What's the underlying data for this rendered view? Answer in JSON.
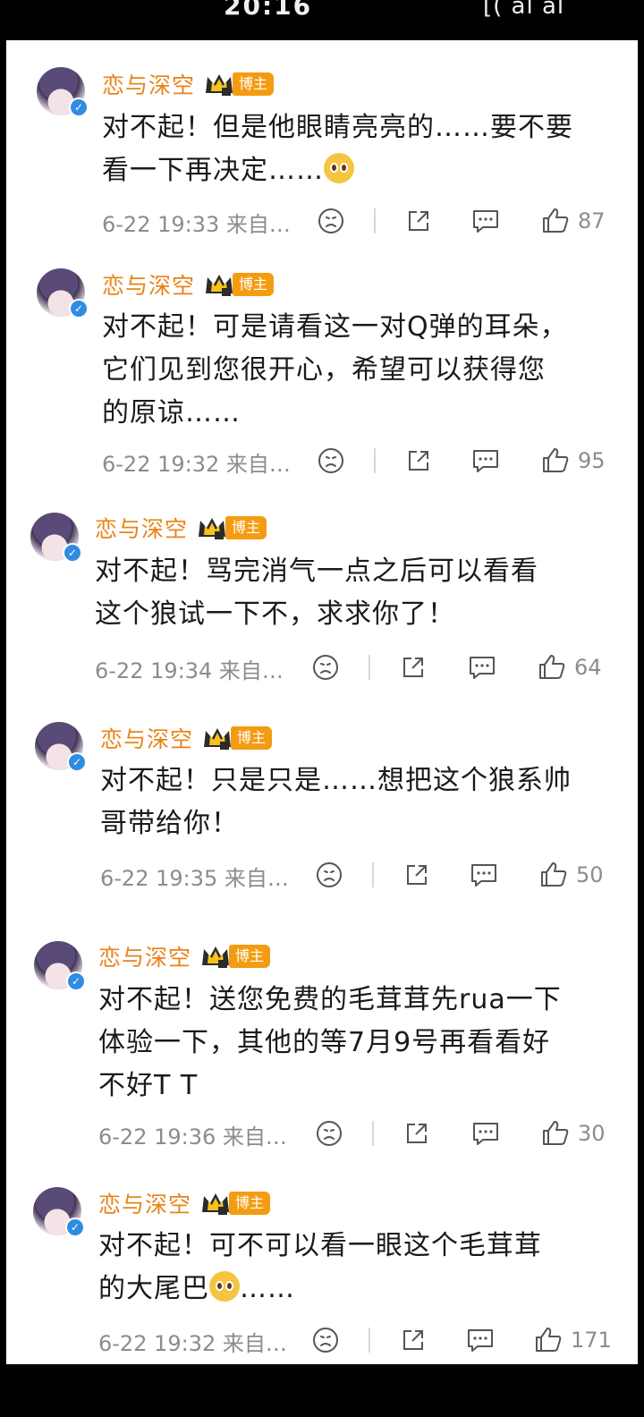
{
  "status_bar": {
    "time": "20:16",
    "icons": "[( al al"
  },
  "colors": {
    "username": "#e88418",
    "badge": "#f39c12",
    "verified": "#2f8ce0",
    "meta": "#8c8c8c"
  },
  "comments": [
    {
      "author": "恋与深空",
      "badge": "博主",
      "text": "对不起！但是他眼睛亮亮的……要不要\n看一下再决定……",
      "emoji": "pleading-face",
      "time": "6-22 19:33",
      "source": "来自…",
      "likes": "87"
    },
    {
      "author": "恋与深空",
      "badge": "博主",
      "text": "对不起！可是请看这一对Q弹的耳朵，\n它们见到您很开心，希望可以获得您\n的原谅……",
      "emoji": "",
      "time": "6-22 19:32",
      "source": "来自…",
      "likes": "95"
    },
    {
      "author": "恋与深空",
      "badge": "博主",
      "text": "对不起！骂完消气一点之后可以看看\n这个狼试一下不，求求你了！",
      "emoji": "",
      "time": "6-22 19:34",
      "source": "来自…",
      "likes": "64"
    },
    {
      "author": "恋与深空",
      "badge": "博主",
      "text": "对不起！只是只是……想把这个狼系帅\n哥带给你！",
      "emoji": "",
      "time": "6-22 19:35",
      "source": "来自…",
      "likes": "50"
    },
    {
      "author": "恋与深空",
      "badge": "博主",
      "text": "对不起！送您免费的毛茸茸先rua一下\n体验一下，其他的等7月9号再看看好\n不好T T",
      "emoji": "",
      "time": "6-22 19:36",
      "source": "来自…",
      "likes": "30"
    },
    {
      "author": "恋与深空",
      "badge": "博主",
      "text": "对不起！可不可以看一眼这个毛茸茸\n的大尾巴",
      "emoji": "pleading-face",
      "text_after_emoji": "……",
      "time": "6-22 19:32",
      "source": "来自…",
      "likes": "171"
    }
  ]
}
